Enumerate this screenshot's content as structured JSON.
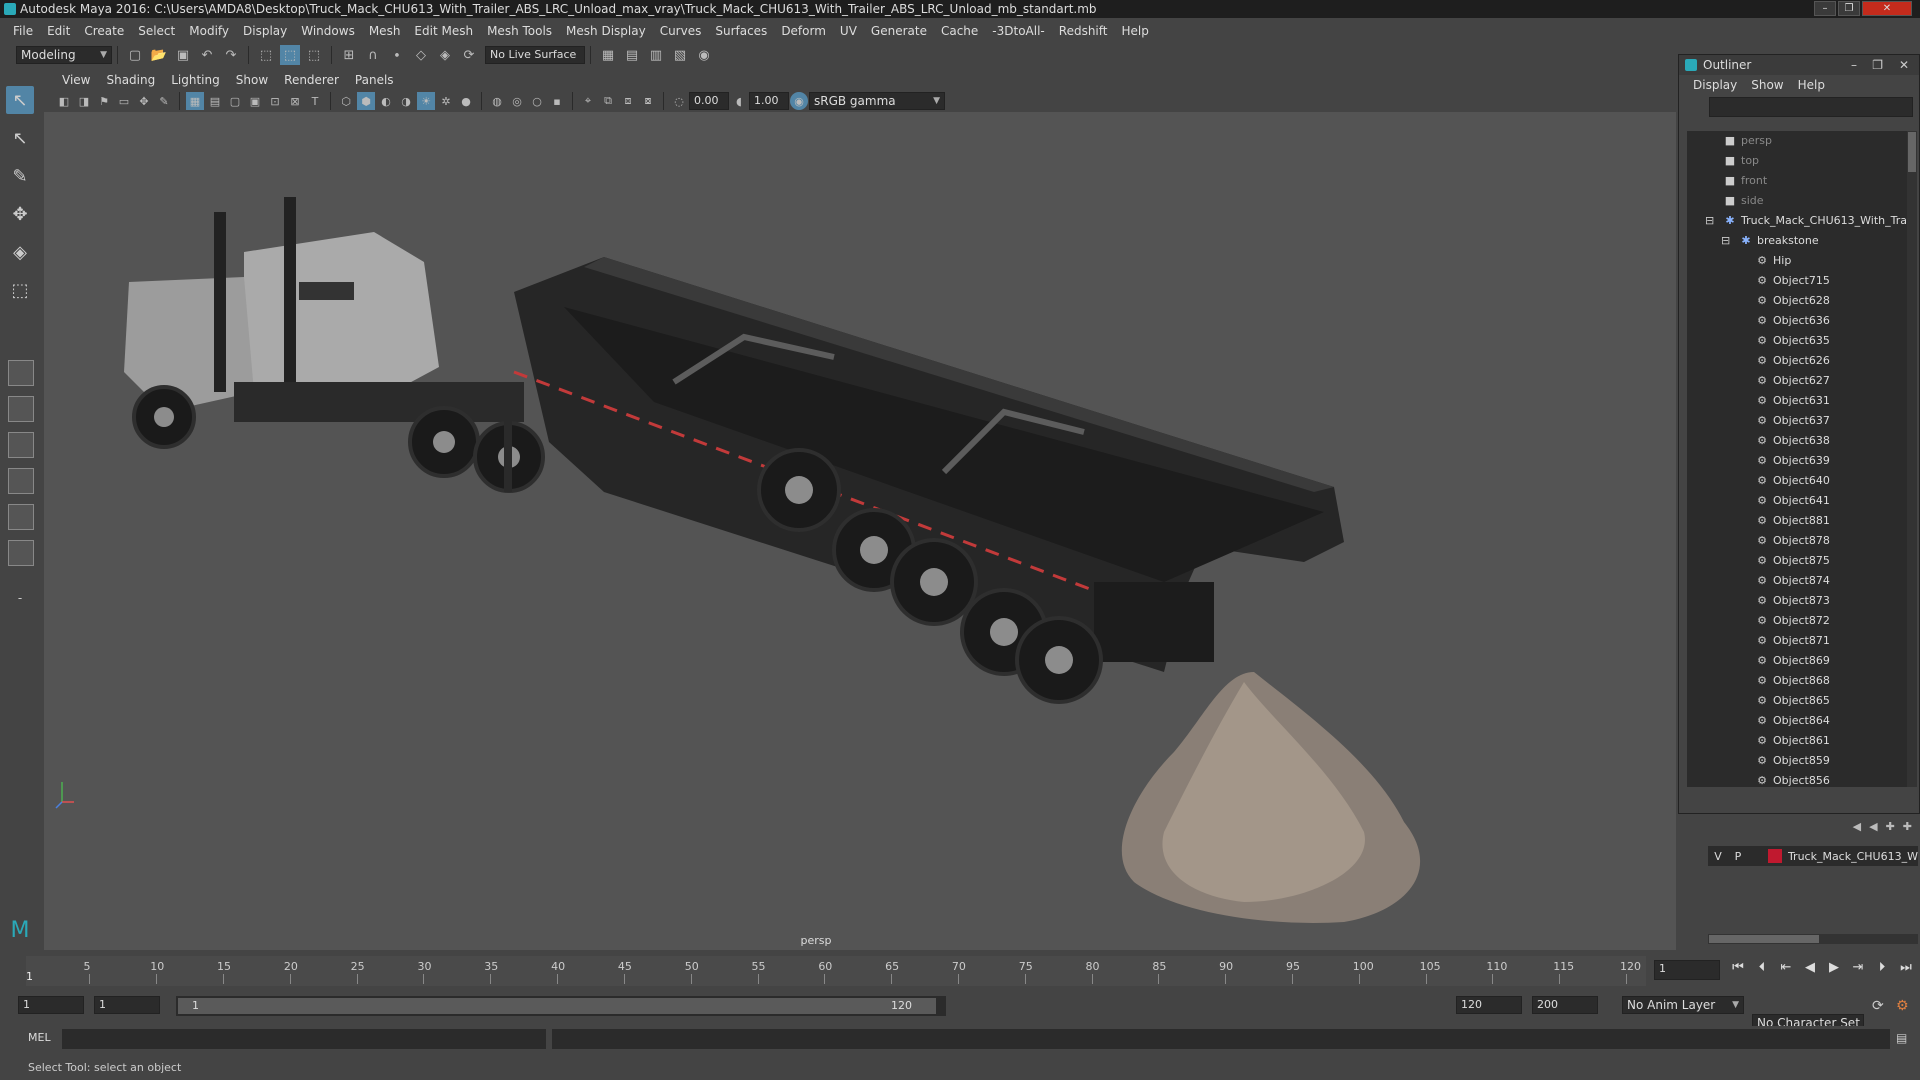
{
  "window": {
    "title": "Autodesk Maya 2016: C:\\Users\\AMDA8\\Desktop\\Truck_Mack_CHU613_With_Trailer_ABS_LRC_Unload_max_vray\\Truck_Mack_CHU613_With_Trailer_ABS_LRC_Unload_mb_standart.mb"
  },
  "menubar": [
    "File",
    "Edit",
    "Create",
    "Select",
    "Modify",
    "Display",
    "Windows",
    "Mesh",
    "Edit Mesh",
    "Mesh Tools",
    "Mesh Display",
    "Curves",
    "Surfaces",
    "Deform",
    "UV",
    "Generate",
    "Cache",
    "-3DtoAll-",
    "Redshift",
    "Help"
  ],
  "shelf": {
    "mode": "Modeling",
    "live_surface": "No Live Surface"
  },
  "viewport": {
    "menu": [
      "View",
      "Shading",
      "Lighting",
      "Show",
      "Renderer",
      "Panels"
    ],
    "exposure": "0.00",
    "gamma": "1.00",
    "color_space": "sRGB gamma",
    "camera": "persp"
  },
  "outliner": {
    "title": "Outliner",
    "menu": [
      "Display",
      "Show",
      "Help"
    ],
    "items": [
      {
        "label": "persp",
        "type": "camera",
        "depth": 0
      },
      {
        "label": "top",
        "type": "camera",
        "depth": 0
      },
      {
        "label": "front",
        "type": "camera",
        "depth": 0
      },
      {
        "label": "side",
        "type": "camera",
        "depth": 0
      },
      {
        "label": "Truck_Mack_CHU613_With_Trai",
        "type": "group",
        "depth": 0
      },
      {
        "label": "breakstone",
        "type": "group",
        "depth": 1
      },
      {
        "label": "Hip",
        "type": "mesh",
        "depth": 2
      },
      {
        "label": "Object715",
        "type": "mesh",
        "depth": 2
      },
      {
        "label": "Object628",
        "type": "mesh",
        "depth": 2
      },
      {
        "label": "Object636",
        "type": "mesh",
        "depth": 2
      },
      {
        "label": "Object635",
        "type": "mesh",
        "depth": 2
      },
      {
        "label": "Object626",
        "type": "mesh",
        "depth": 2
      },
      {
        "label": "Object627",
        "type": "mesh",
        "depth": 2
      },
      {
        "label": "Object631",
        "type": "mesh",
        "depth": 2
      },
      {
        "label": "Object637",
        "type": "mesh",
        "depth": 2
      },
      {
        "label": "Object638",
        "type": "mesh",
        "depth": 2
      },
      {
        "label": "Object639",
        "type": "mesh",
        "depth": 2
      },
      {
        "label": "Object640",
        "type": "mesh",
        "depth": 2
      },
      {
        "label": "Object641",
        "type": "mesh",
        "depth": 2
      },
      {
        "label": "Object881",
        "type": "mesh",
        "depth": 2
      },
      {
        "label": "Object878",
        "type": "mesh",
        "depth": 2
      },
      {
        "label": "Object875",
        "type": "mesh",
        "depth": 2
      },
      {
        "label": "Object874",
        "type": "mesh",
        "depth": 2
      },
      {
        "label": "Object873",
        "type": "mesh",
        "depth": 2
      },
      {
        "label": "Object872",
        "type": "mesh",
        "depth": 2
      },
      {
        "label": "Object871",
        "type": "mesh",
        "depth": 2
      },
      {
        "label": "Object869",
        "type": "mesh",
        "depth": 2
      },
      {
        "label": "Object868",
        "type": "mesh",
        "depth": 2
      },
      {
        "label": "Object865",
        "type": "mesh",
        "depth": 2
      },
      {
        "label": "Object864",
        "type": "mesh",
        "depth": 2
      },
      {
        "label": "Object861",
        "type": "mesh",
        "depth": 2
      },
      {
        "label": "Object859",
        "type": "mesh",
        "depth": 2
      },
      {
        "label": "Object856",
        "type": "mesh",
        "depth": 2
      }
    ]
  },
  "layers": {
    "v": "V",
    "p": "P",
    "name": "Truck_Mack_CHU613_W",
    "color": "#c0192f"
  },
  "timeline": {
    "ticks": [
      "5",
      "10",
      "15",
      "20",
      "25",
      "30",
      "35",
      "40",
      "45",
      "50",
      "55",
      "60",
      "65",
      "70",
      "75",
      "80",
      "85",
      "90",
      "95",
      "100",
      "105",
      "110",
      "115",
      "120"
    ],
    "start_marker": "1",
    "current_frame": "1"
  },
  "range": {
    "start": "1",
    "playback_start": "1",
    "slider_start": "1",
    "slider_end": "120",
    "playback_end": "120",
    "end": "200",
    "anim_layer": "No Anim Layer",
    "character_set": "No Character Set"
  },
  "cmdline": {
    "label": "MEL"
  },
  "helpline": {
    "text": "Select Tool: select an object"
  }
}
